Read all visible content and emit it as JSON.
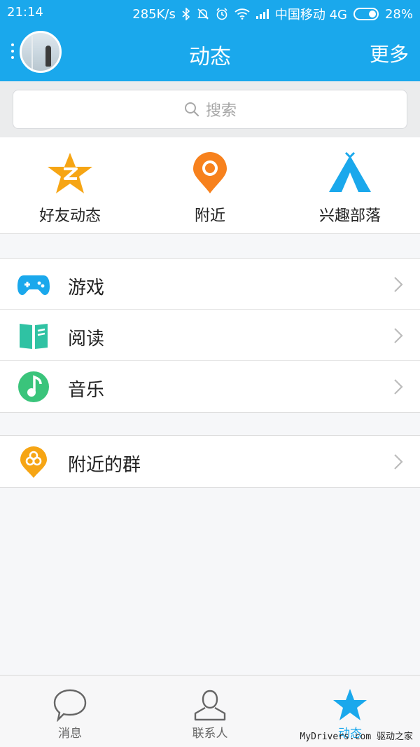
{
  "status": {
    "time": "21:14",
    "speed": "285K/s",
    "carrier": "中国移动 4G",
    "battery": "28%"
  },
  "header": {
    "title": "动态",
    "more": "更多"
  },
  "search": {
    "placeholder": "搜索"
  },
  "quick": [
    {
      "label": "好友动态",
      "icon": "qzone-star-icon",
      "color": "#f6a514"
    },
    {
      "label": "附近",
      "icon": "location-pin-icon",
      "color": "#f7811d"
    },
    {
      "label": "兴趣部落",
      "icon": "tent-icon",
      "color": "#1aa8ec"
    }
  ],
  "list1": [
    {
      "label": "游戏",
      "icon": "gamepad-icon",
      "color": "#1aa8ec"
    },
    {
      "label": "阅读",
      "icon": "book-icon",
      "color": "#2fc2a3"
    },
    {
      "label": "音乐",
      "icon": "music-note-icon",
      "color": "#3ac47b"
    }
  ],
  "list2": [
    {
      "label": "附近的群",
      "icon": "nearby-group-icon",
      "color": "#f6a514"
    }
  ],
  "tabs": [
    {
      "label": "消息",
      "icon": "chat-bubble-icon"
    },
    {
      "label": "联系人",
      "icon": "contact-person-icon"
    },
    {
      "label": "动态",
      "icon": "star-icon",
      "active": true
    }
  ],
  "watermark": "MyDrivers.com 驱动之家"
}
